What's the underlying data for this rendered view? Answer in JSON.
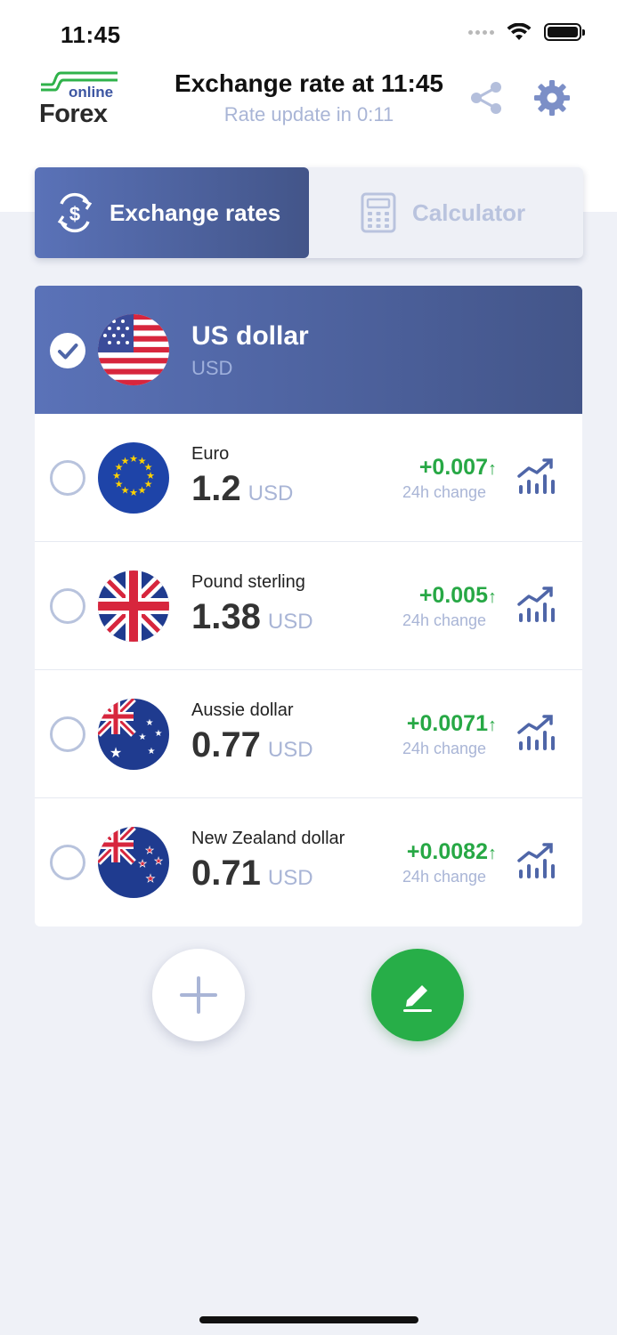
{
  "status_bar": {
    "time": "11:45"
  },
  "header": {
    "logo_online": "online",
    "logo_forex": "Forex",
    "title": "Exchange rate at 11:45",
    "subtitle": "Rate update in 0:11"
  },
  "tabs": [
    {
      "label": "Exchange rates",
      "active": true
    },
    {
      "label": "Calculator",
      "active": false
    }
  ],
  "base_currency": {
    "name": "US dollar",
    "code": "USD",
    "flag": "us-flag-icon"
  },
  "currencies": [
    {
      "name": "Euro",
      "rate": "1.2",
      "unit": "USD",
      "change": "+0.007",
      "change_label": "24h change",
      "flag": "eu-flag-icon"
    },
    {
      "name": "Pound sterling",
      "rate": "1.38",
      "unit": "USD",
      "change": "+0.005",
      "change_label": "24h change",
      "flag": "uk-flag-icon"
    },
    {
      "name": "Aussie dollar",
      "rate": "0.77",
      "unit": "USD",
      "change": "+0.0071",
      "change_label": "24h change",
      "flag": "au-flag-icon"
    },
    {
      "name": "New Zealand dollar",
      "rate": "0.71",
      "unit": "USD",
      "change": "+0.0082",
      "change_label": "24h change",
      "flag": "nz-flag-icon"
    }
  ],
  "colors": {
    "accent": "#4f66a8",
    "positive": "#27a845",
    "muted": "#a9b5d6",
    "fab_edit": "#27ae48"
  }
}
